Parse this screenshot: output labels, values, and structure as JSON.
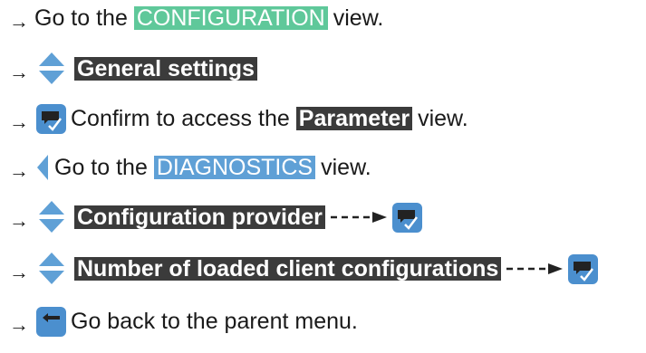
{
  "arrow": "→",
  "lines": [
    {
      "pre": "Go to the",
      "tag": "CONFIGURATION",
      "post": "view."
    },
    {
      "tag": "General settings"
    },
    {
      "text": "Confirm to access the",
      "tag": "Parameter",
      "post": "view."
    },
    {
      "text": "Go to the",
      "tag": "DIAGNOSTICS",
      "post": "view."
    },
    {
      "tag": "Configuration provider"
    },
    {
      "tag": "Number of loaded client configurations"
    },
    {
      "text": "Go back to the parent menu."
    }
  ],
  "colors": {
    "nav_arrow": "#5fa0d6",
    "button_fill": "#4b8fce",
    "button_icon": "#222222",
    "tag_green": "#5fc89a",
    "tag_blue": "#5fa0d6",
    "tag_dark": "#3b3b3b"
  },
  "icons": {
    "up_down": "up-down-arrows-icon",
    "left": "left-arrow-icon",
    "confirm": "confirm-button-icon",
    "back": "back-button-icon",
    "dashed": "dashed-arrow-icon"
  }
}
